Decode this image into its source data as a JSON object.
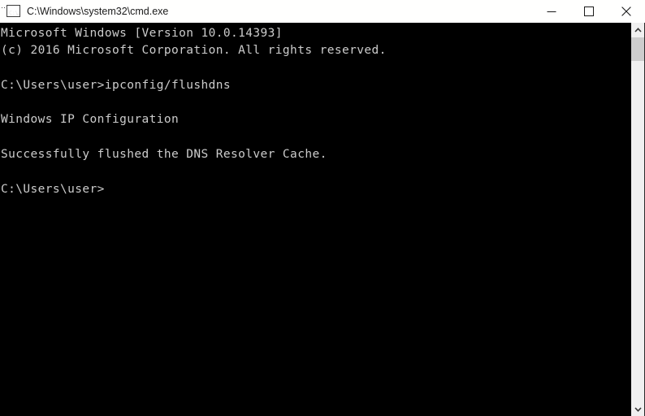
{
  "window": {
    "title": "C:\\Windows\\system32\\cmd.exe",
    "icon": "cmd-console-icon",
    "icon_prompt_text": "C:\\",
    "background_color": "#000000",
    "titlebar_color": "#fffffe",
    "titlebar_text_color": "#1a1a1a"
  },
  "titlebar_controls": [
    {
      "name": "minimize",
      "label": "Minimize",
      "icon": "minimize-icon"
    },
    {
      "name": "maximize",
      "label": "Maximize",
      "icon": "maximize-icon"
    },
    {
      "name": "close",
      "label": "Close",
      "icon": "close-icon"
    }
  ],
  "console": {
    "foreground_color": "#cccccc",
    "background_color": "#000000",
    "lines": [
      "Microsoft Windows [Version 10.0.14393]",
      "(c) 2016 Microsoft Corporation. All rights reserved.",
      "",
      "C:\\Users\\user>ipconfig/flushdns",
      "",
      "Windows IP Configuration",
      "",
      "Successfully flushed the DNS Resolver Cache.",
      "",
      "C:\\Users\\user>"
    ],
    "line_0": "Microsoft Windows [Version 10.0.14393]",
    "line_1": "(c) 2016 Microsoft Corporation. All rights reserved.",
    "line_2": "",
    "line_3": "C:\\Users\\user>ipconfig/flushdns",
    "line_4": "",
    "line_5": "Windows IP Configuration",
    "line_6": "",
    "line_7": "Successfully flushed the DNS Resolver Cache.",
    "line_8": "",
    "line_9": "C:\\Users\\user>"
  },
  "scrollbar": {
    "up_arrow_icon": "chevron-up-icon",
    "down_arrow_icon": "chevron-down-icon",
    "thumb_color": "#cdcdcd",
    "track_color": "#f0f0f0"
  }
}
